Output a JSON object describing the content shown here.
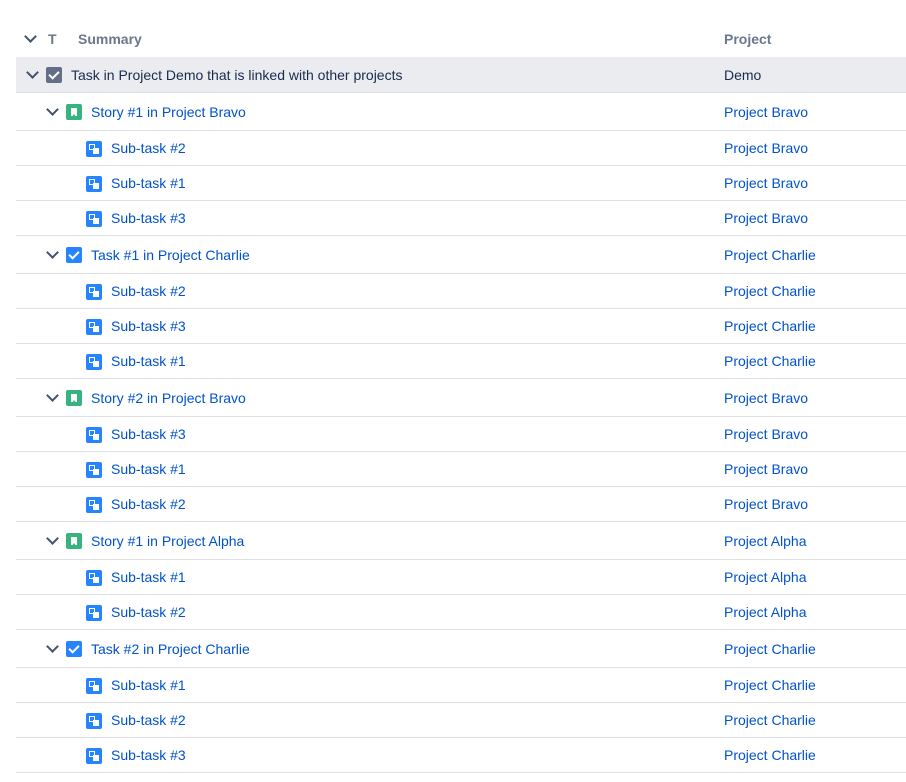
{
  "header": {
    "type": "T",
    "summary": "Summary",
    "project": "Project"
  },
  "rows": [
    {
      "level": 0,
      "type": "task-root",
      "summary": "Task in Project Demo that is linked with other projects",
      "project": "Demo"
    },
    {
      "level": 1,
      "type": "story",
      "summary": "Story #1 in Project Bravo",
      "project": "Project Bravo"
    },
    {
      "level": 2,
      "type": "subtask",
      "summary": "Sub-task #2",
      "project": "Project Bravo"
    },
    {
      "level": 2,
      "type": "subtask",
      "summary": "Sub-task #1",
      "project": "Project Bravo"
    },
    {
      "level": 2,
      "type": "subtask",
      "summary": "Sub-task #3",
      "project": "Project Bravo"
    },
    {
      "level": 1,
      "type": "task",
      "summary": "Task #1 in Project Charlie",
      "project": "Project Charlie"
    },
    {
      "level": 2,
      "type": "subtask",
      "summary": "Sub-task #2",
      "project": "Project Charlie"
    },
    {
      "level": 2,
      "type": "subtask",
      "summary": "Sub-task #3",
      "project": "Project Charlie"
    },
    {
      "level": 2,
      "type": "subtask",
      "summary": "Sub-task #1",
      "project": "Project Charlie"
    },
    {
      "level": 1,
      "type": "story",
      "summary": "Story #2 in Project Bravo",
      "project": "Project Bravo"
    },
    {
      "level": 2,
      "type": "subtask",
      "summary": "Sub-task #3",
      "project": "Project Bravo"
    },
    {
      "level": 2,
      "type": "subtask",
      "summary": "Sub-task #1",
      "project": "Project Bravo"
    },
    {
      "level": 2,
      "type": "subtask",
      "summary": "Sub-task #2",
      "project": "Project Bravo"
    },
    {
      "level": 1,
      "type": "story",
      "summary": "Story #1 in Project Alpha",
      "project": "Project Alpha"
    },
    {
      "level": 2,
      "type": "subtask",
      "summary": "Sub-task #1",
      "project": "Project Alpha"
    },
    {
      "level": 2,
      "type": "subtask",
      "summary": "Sub-task #2",
      "project": "Project Alpha"
    },
    {
      "level": 1,
      "type": "task",
      "summary": "Task #2 in Project Charlie",
      "project": "Project Charlie"
    },
    {
      "level": 2,
      "type": "subtask",
      "summary": "Sub-task #1",
      "project": "Project Charlie"
    },
    {
      "level": 2,
      "type": "subtask",
      "summary": "Sub-task #2",
      "project": "Project Charlie"
    },
    {
      "level": 2,
      "type": "subtask",
      "summary": "Sub-task #3",
      "project": "Project Charlie"
    }
  ],
  "colors": {
    "link": "#0052cc",
    "text": "#172b4d",
    "header": "#6b778c",
    "story": "#36b37e",
    "task": "#2684ff",
    "subtask": "#2684ff",
    "root_icon": "#626f86",
    "root_row_bg": "#ebecf0",
    "divider": "#dfe1e6"
  },
  "icons": {
    "collapse": "chevron-down-icon",
    "task-root": "checkbox-icon",
    "task": "checkbox-icon",
    "story": "story-icon",
    "subtask": "subtask-icon"
  }
}
